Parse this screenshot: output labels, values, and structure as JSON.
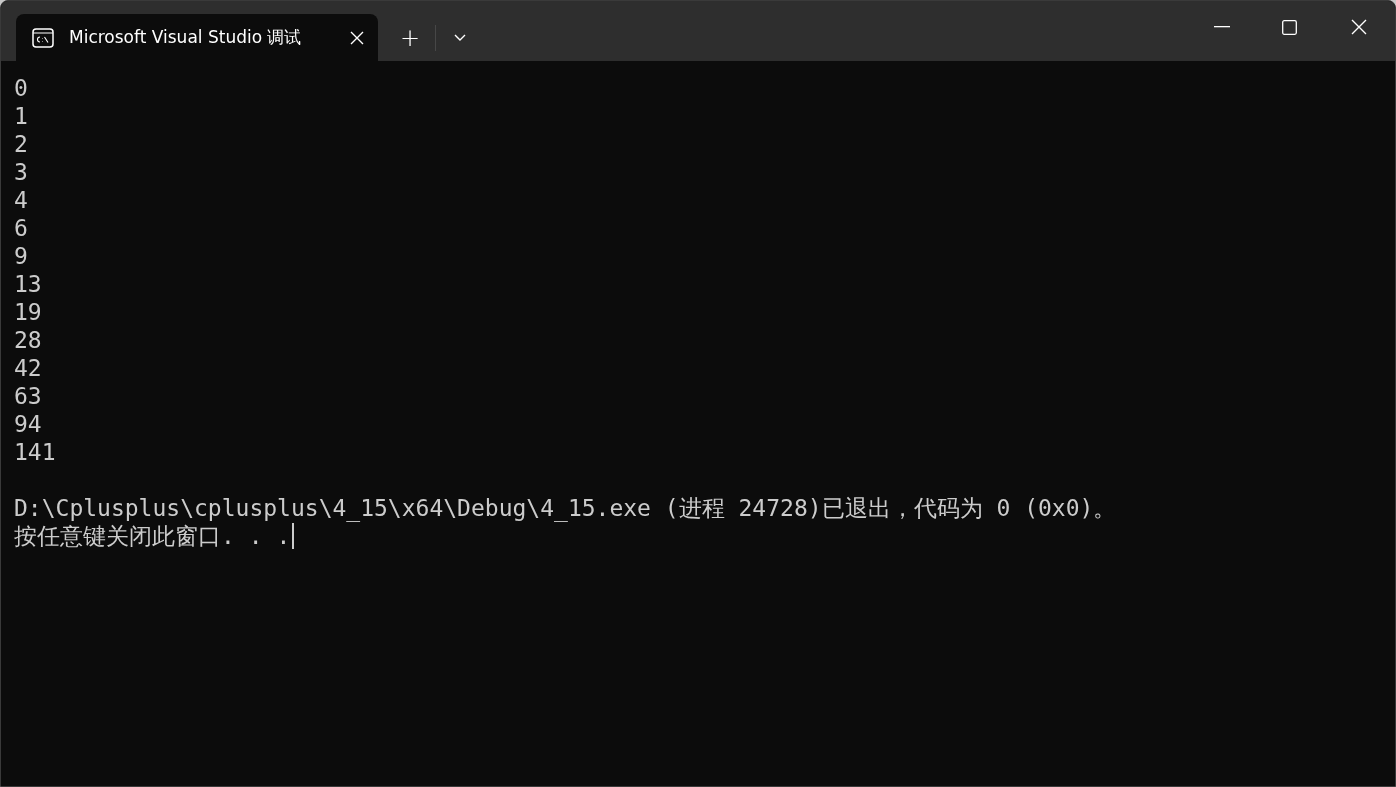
{
  "window": {
    "tab_title": "Microsoft Visual Studio 调试",
    "tab_selected": true,
    "new_tab": "+"
  },
  "console": {
    "output": [
      "0",
      "1",
      "2",
      "3",
      "4",
      "6",
      "9",
      "13",
      "19",
      "28",
      "42",
      "63",
      "94",
      "141"
    ],
    "exit_messages": [
      "D:\\Cplusplus\\cplusplus\\4_15\\x64\\Debug\\4_15.exe (进程 24728)已退出，代码为 0 (0x0)。",
      "按任意键关闭此窗口. . ."
    ],
    "cursor_visible": true
  }
}
